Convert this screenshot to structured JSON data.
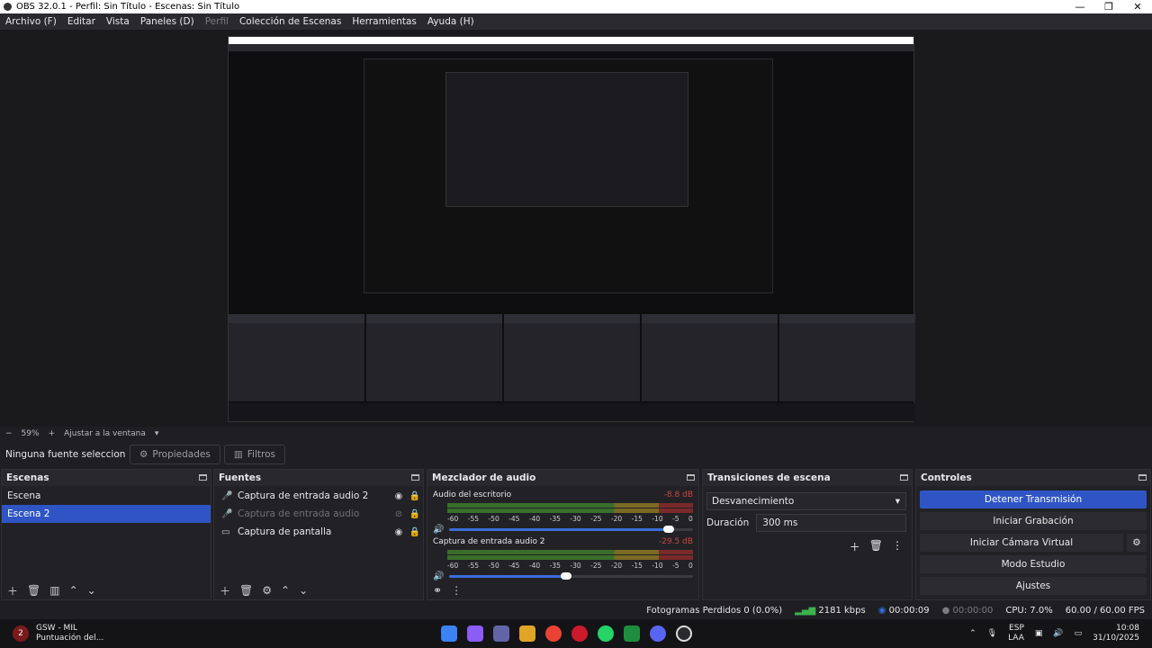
{
  "window": {
    "title": "OBS 32.0.1 - Perfil: Sin Título - Escenas: Sin Título",
    "minimize": "—",
    "maximize": "❐",
    "close": "✕"
  },
  "menu": [
    "Archivo (F)",
    "Editar",
    "Vista",
    "Paneles (D)",
    "Perfil",
    "Colección de Escenas",
    "Herramientas",
    "Ayuda (H)"
  ],
  "zoom": {
    "minus": "−",
    "value": "59%",
    "plus": "+",
    "fit": "Ajustar a la ventana"
  },
  "source_toolbar": {
    "no_source": "Ninguna fuente seleccionada",
    "properties": "Propiedades",
    "filters": "Filtros"
  },
  "scenes": {
    "title": "Escenas",
    "items": [
      "Escena",
      "Escena 2"
    ],
    "selected_index": 1
  },
  "sources": {
    "title": "Fuentes",
    "items": [
      {
        "name": "Captura de entrada audio 2",
        "icon": "mic-icon",
        "visible": true
      },
      {
        "name": "Captura de entrada audio",
        "icon": "mic-icon",
        "visible": false
      },
      {
        "name": "Captura de pantalla",
        "icon": "monitor-icon",
        "visible": true
      }
    ]
  },
  "mixer": {
    "title": "Mezclador de audio",
    "ticks": [
      "-60",
      "-55",
      "-50",
      "-45",
      "-40",
      "-35",
      "-30",
      "-25",
      "-20",
      "-15",
      "-10",
      "-5",
      "0"
    ],
    "channels": [
      {
        "name": "Audio del escritorio",
        "db": "-8.8 dB",
        "volume": 0.9
      },
      {
        "name": "Captura de entrada audio 2",
        "db": "-29.5 dB",
        "volume": 0.48
      }
    ]
  },
  "transitions": {
    "title": "Transiciones de escena",
    "selected": "Desvanecimiento",
    "duration_label": "Duración",
    "duration_value": "300 ms"
  },
  "controls": {
    "title": "Controles",
    "stop_stream": "Detener Transmisión",
    "start_recording": "Iniciar Grabación",
    "start_vcam": "Iniciar Cámara Virtual",
    "studio_mode": "Modo Estudio",
    "settings": "Ajustes"
  },
  "status": {
    "dropped": "Fotogramas Perdidos 0 (0.0%)",
    "bitrate": "2181 kbps",
    "stream_time": "00:00:09",
    "rec_time": "00:00:00",
    "cpu": "CPU: 7.0%",
    "fps": "60.00 / 60.00 FPS"
  },
  "taskbar": {
    "app_name": "GSW - MIL",
    "app_sub": "Puntuación del...",
    "badge": "2",
    "lang1": "ESP",
    "lang2": "LAA",
    "time": "10:08",
    "date": "31/10/2025"
  },
  "colors": {
    "accent": "#2f55c5",
    "panel": "#222226"
  }
}
